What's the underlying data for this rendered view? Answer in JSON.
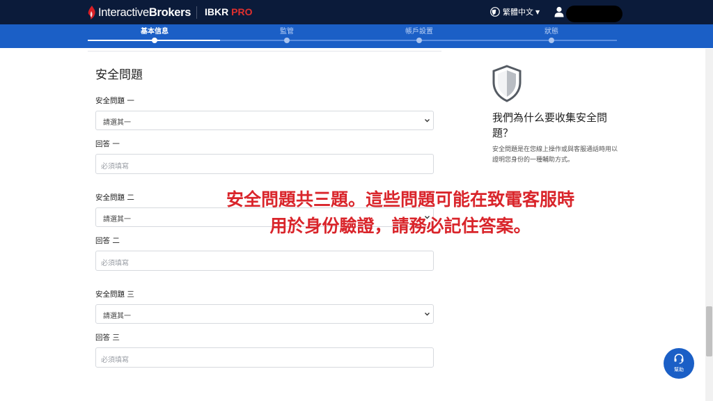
{
  "header": {
    "logo_regular": "Interactive",
    "logo_bold": "Brokers",
    "product_main": "IBKR ",
    "product_accent": "PRO",
    "language": "繁體中文",
    "brand_color": "#d81f26",
    "bar_color": "#0b1b3a"
  },
  "steps": [
    {
      "label": "基本信息",
      "active": true
    },
    {
      "label": "監管",
      "active": false
    },
    {
      "label": "帳戶設置",
      "active": false
    },
    {
      "label": "狀態",
      "active": false
    }
  ],
  "form": {
    "title": "安全問題",
    "questions": [
      {
        "question_label": "安全問題 一",
        "select_value": "請選其一",
        "answer_label": "回答 一",
        "answer_placeholder": "必須填寫"
      },
      {
        "question_label": "安全問題 二",
        "select_value": "請選其一",
        "answer_label": "回答 二",
        "answer_placeholder": "必須填寫"
      },
      {
        "question_label": "安全問題 三",
        "select_value": "請選其一",
        "answer_label": "回答 三",
        "answer_placeholder": "必須填寫"
      }
    ]
  },
  "sidebar": {
    "title": "我們為什么要收集安全問題？",
    "body": "安全問題是在您線上操作或與客服通話時用以證明您身份的一種輔助方式。"
  },
  "overlay": {
    "line1": "安全問題共三題。這些問題可能在致電客服時",
    "line2": "用於身份驗證，請務必記住答案。",
    "color": "#d9252b"
  },
  "help": {
    "label": "幫助"
  }
}
